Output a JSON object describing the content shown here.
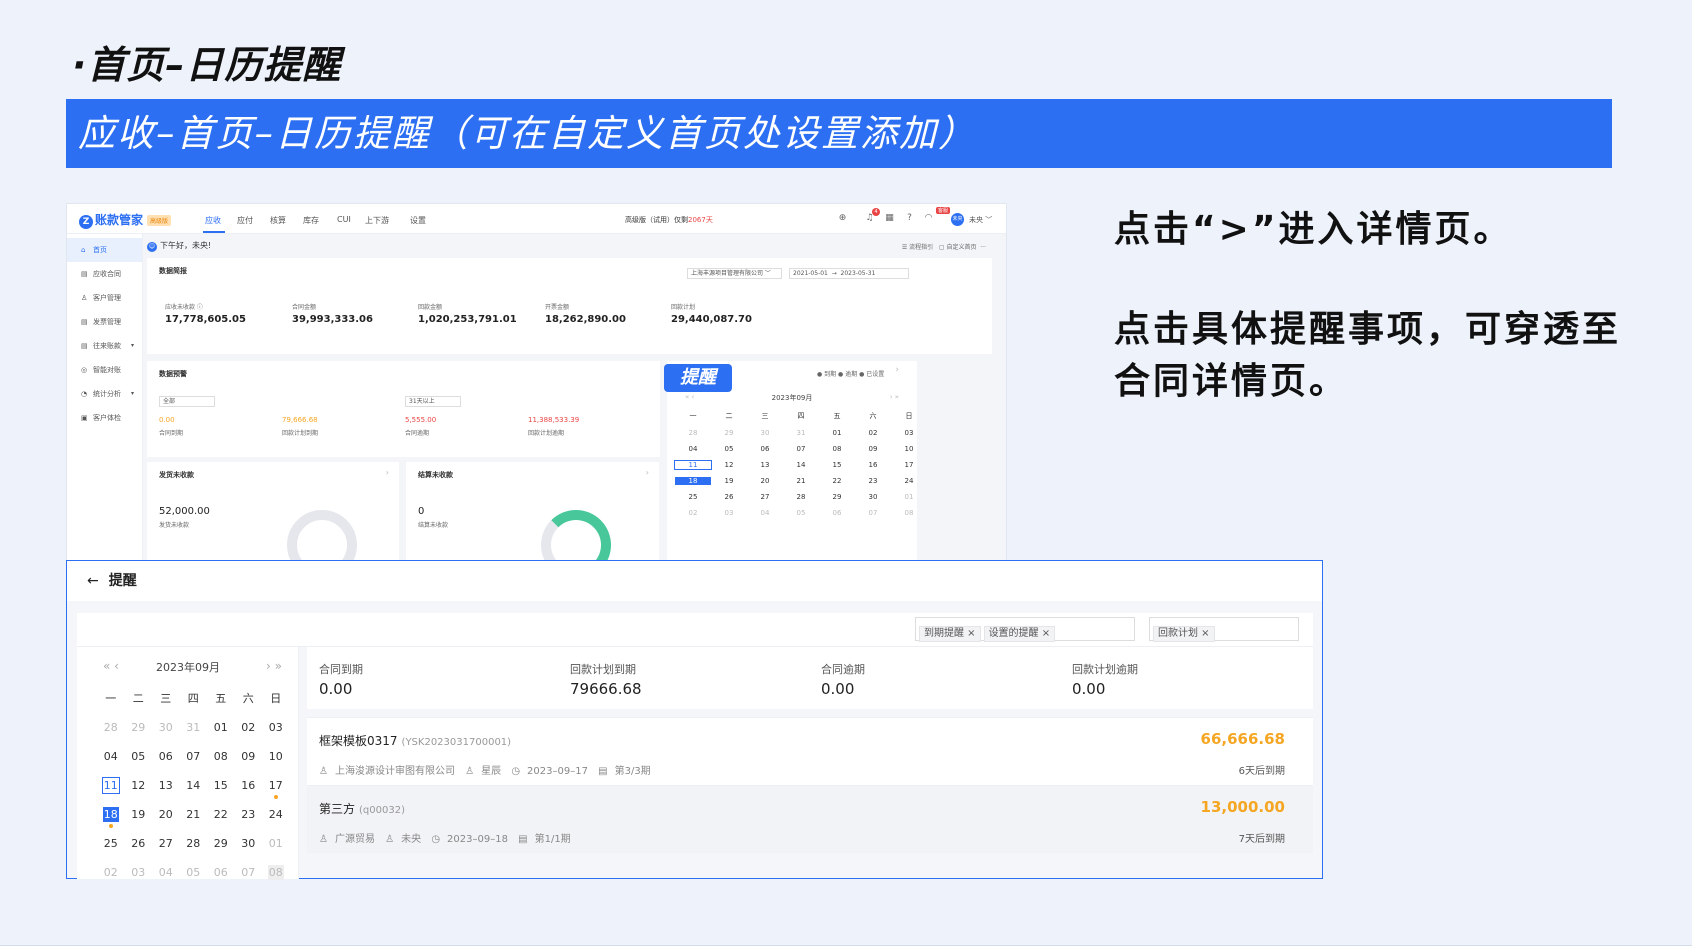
{
  "slide": {
    "title": "·首页–日历提醒",
    "banner": "应收–首页–日历提醒（可在自定义首页处设置添加）",
    "note1": "点击“>”进入详情页。",
    "note2": "点击具体提醒事项，可穿透至合同详情页。",
    "callout": "提醒"
  },
  "app": {
    "logo": "账款管家",
    "logo_mark": "Z",
    "logo_badge": "高级版",
    "nav": [
      "应收",
      "应付",
      "核算",
      "库存",
      "CUI",
      "上下游",
      "设置"
    ],
    "edition": "高级版（试用）仅剩",
    "edition_days": "2067天",
    "msg_count": "4",
    "kefu_badge": "客服",
    "avatar": "未央",
    "username": "未央 ﹀",
    "greeting": "下午好，未央!",
    "toolbar_flow": "☰ 流程指引",
    "toolbar_custom": "▢ 自定义首页",
    "sidebar": [
      {
        "icon": "⌂",
        "label": "首页"
      },
      {
        "icon": "▤",
        "label": "应收合同"
      },
      {
        "icon": "♙",
        "label": "客户管理"
      },
      {
        "icon": "▤",
        "label": "发票管理"
      },
      {
        "icon": "▤",
        "label": "往来账款"
      },
      {
        "icon": "◎",
        "label": "智能对账"
      },
      {
        "icon": "◔",
        "label": "统计分析"
      },
      {
        "icon": "▣",
        "label": "客户体检"
      }
    ],
    "summary": {
      "title": "数据简报",
      "company": "上海丰源项目管理有限公司 ﹀",
      "date_from": "2021-05-01",
      "date_to": "2023-05-31",
      "items": [
        {
          "label": "应收未收款 ⓘ",
          "value": "17,778,605.05"
        },
        {
          "label": "合同金额",
          "value": "39,993,333.06"
        },
        {
          "label": "回款金额",
          "value": "1,020,253,791.01"
        },
        {
          "label": "开票金额",
          "value": "18,262,890.00"
        },
        {
          "label": "回款计划",
          "value": "29,440,087.70"
        }
      ]
    },
    "warning": {
      "title": "数据预警",
      "sel1": "全部",
      "sel2": "31天以上",
      "items": [
        {
          "value": "0.00",
          "label": "合同到期",
          "color": "#f5a623"
        },
        {
          "value": "79,666.68",
          "label": "回款计划到期",
          "color": "#f5a623"
        },
        {
          "value": "5,555.00",
          "label": "合同逾期",
          "color": "#e94545"
        },
        {
          "value": "11,388,533.39",
          "label": "回款计划逾期",
          "color": "#e94545"
        }
      ]
    },
    "unpaid": {
      "title": "发货未收款",
      "value": "52,000.00",
      "label": "发货未收款"
    },
    "settle": {
      "title": "结算未收款",
      "value": "0",
      "label": "结算未收款"
    },
    "remind_card": {
      "title": "提醒",
      "legend": "● 到期  ● 逾期  ● 已设置",
      "month": "2023年09月"
    }
  },
  "calendar": {
    "month": "2023年09月",
    "weekdays": [
      "一",
      "二",
      "三",
      "四",
      "五",
      "六",
      "日"
    ],
    "days": [
      "28",
      "29",
      "30",
      "31",
      "01",
      "02",
      "03",
      "04",
      "05",
      "06",
      "07",
      "08",
      "09",
      "10",
      "11",
      "12",
      "13",
      "14",
      "15",
      "16",
      "17",
      "18",
      "19",
      "20",
      "21",
      "22",
      "23",
      "24",
      "25",
      "26",
      "27",
      "28",
      "29",
      "30",
      "01",
      "02",
      "03",
      "04",
      "05",
      "06",
      "07",
      "08"
    ]
  },
  "detail": {
    "title": "提醒",
    "filter_chips_1": [
      "到期提醒 ×",
      "设置的提醒 ×"
    ],
    "filter_chips_2": [
      "回款计划 ×"
    ],
    "summary": [
      {
        "label": "合同到期",
        "value": "0.00"
      },
      {
        "label": "回款计划到期",
        "value": "79666.68"
      },
      {
        "label": "合同逾期",
        "value": "0.00"
      },
      {
        "label": "回款计划逾期",
        "value": "0.00"
      }
    ],
    "items": [
      {
        "name": "框架模板0317",
        "code": "(YSK2023031700001)",
        "amount": "66,666.68",
        "company": "上海浚源设计审图有限公司",
        "person": "星辰",
        "date": "2023–09–17",
        "period": "第3/3期",
        "due": "6天后到期"
      },
      {
        "name": "第三方",
        "code": "(q00032)",
        "amount": "13,000.00",
        "company": "广源贸易",
        "person": "未央",
        "date": "2023–09–18",
        "period": "第1/1期",
        "due": "7天后到期"
      }
    ]
  }
}
